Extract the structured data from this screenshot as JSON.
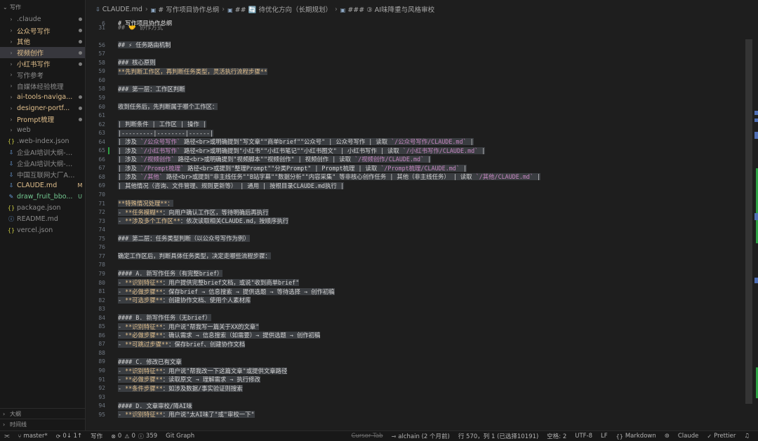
{
  "sidebar": {
    "header": "写作",
    "items": [
      {
        "label": ".claude",
        "type": "folder",
        "color": "gray",
        "deco": "dot"
      },
      {
        "label": "公众号写作",
        "type": "folder",
        "color": "yellow",
        "deco": "dot"
      },
      {
        "label": "其他",
        "type": "folder",
        "color": "yellow",
        "deco": "dot"
      },
      {
        "label": "视频创作",
        "type": "folder",
        "color": "yellow",
        "deco": "dot",
        "selected": true
      },
      {
        "label": "小红书写作",
        "type": "folder",
        "color": "yellow",
        "deco": "dot"
      },
      {
        "label": "写作参考",
        "type": "folder",
        "color": "gray",
        "deco": ""
      },
      {
        "label": "自媒体经验梳理",
        "type": "folder",
        "color": "gray",
        "deco": ""
      },
      {
        "label": "ai-tools-naviga...",
        "type": "folder",
        "color": "yellow",
        "deco": "dot"
      },
      {
        "label": "designer-portf...",
        "type": "folder",
        "color": "yellow",
        "deco": "dot"
      },
      {
        "label": "Prompt梳理",
        "type": "folder",
        "color": "yellow",
        "deco": "dot"
      },
      {
        "label": "web",
        "type": "folder",
        "color": "gray",
        "deco": ""
      },
      {
        "label": ".web-index.json",
        "type": "json",
        "color": "gray",
        "deco": ""
      },
      {
        "label": "企业AI培训大纲-抖音...",
        "type": "md",
        "color": "gray",
        "deco": ""
      },
      {
        "label": "企业AI培训大纲-抖音...",
        "type": "md",
        "color": "gray",
        "deco": ""
      },
      {
        "label": "中国互联网大厂AI编...",
        "type": "md",
        "color": "gray",
        "deco": ""
      },
      {
        "label": "CLAUDE.md",
        "type": "md",
        "color": "yellow",
        "deco": "M"
      },
      {
        "label": "draw_fruit_bbo...",
        "type": "py",
        "color": "green",
        "deco": "U"
      },
      {
        "label": "package.json",
        "type": "json",
        "color": "gray",
        "deco": ""
      },
      {
        "label": "README.md",
        "type": "info",
        "color": "gray",
        "deco": ""
      },
      {
        "label": "vercel.json",
        "type": "json",
        "color": "gray",
        "deco": ""
      }
    ],
    "footer_outline": "大纲",
    "footer_timeline": "时间线"
  },
  "breadcrumb": [
    {
      "icon": "markdown-icon",
      "label": "CLAUDE.md"
    },
    {
      "icon": "heading-icon",
      "label": "# 写作项目协作总纲"
    },
    {
      "icon": "heading-icon",
      "label": "## 🔄 待优化方向（长期规划）"
    },
    {
      "icon": "heading-icon",
      "label": "### ③ AI味降重与风格审校"
    }
  ],
  "sticky": [
    {
      "n": "6",
      "text": "# 写作项目协作总纲"
    },
    {
      "n": "31",
      "text": "## 🤝 协作方式"
    }
  ],
  "lines": [
    {
      "n": "56",
      "text": "## ⚡ 任务路由机制",
      "hl": true
    },
    {
      "n": "57",
      "text": ""
    },
    {
      "n": "58",
      "text": "### 核心原则",
      "hl": true
    },
    {
      "n": "59",
      "text": "**先判断工作区，再判断任务类型，灵活执行流程步骤**",
      "hl": true,
      "color": "yellow"
    },
    {
      "n": "60",
      "text": ""
    },
    {
      "n": "58",
      "text": "### 第一层：工作区判断",
      "hl": true
    },
    {
      "n": "59",
      "text": ""
    },
    {
      "n": "60",
      "text": "收到任务后，先判断属于哪个工作区：",
      "hl": true
    },
    {
      "n": "61",
      "text": ""
    },
    {
      "n": "62",
      "text": "| 判断条件 | 工作区 | 操作 |",
      "hl": true
    },
    {
      "n": "63",
      "text": "|---------|--------|------|",
      "hl": true
    },
    {
      "n": "64",
      "text": "| 涉及 `/公众号写作` 路径<br>或明确提到\"写文章\"\"商单brief\"\"公众号\" | 公众号写作 | 读取 `/公众号写作/CLAUDE.md` |",
      "hl": true,
      "mixed": true
    },
    {
      "n": "65",
      "text": "| 涉及 `/小红书写作` 路径<br>或明确提到\"小红书\"\"小红书笔记\"\"小红书图文\" | 小红书写作 | 读取 `/小红书写作/CLAUDE.md` |",
      "hl": true,
      "mixed": true,
      "mark": true
    },
    {
      "n": "66",
      "text": "| 涉及 `/视频创作` 路径<br>或明确提到\"视频脚本\"\"视频创作\" | 视频创作 | 读取 `/视频创作/CLAUDE.md` |",
      "hl": true,
      "mixed": true
    },
    {
      "n": "67",
      "text": "| 涉及 `/Prompt梳理` 路径<br>或提到\"整理Prompt\"\"分类Prompt\" | Prompt梳理 | 读取 `/Prompt梳理/CLAUDE.md` |",
      "hl": true,
      "mixed": true
    },
    {
      "n": "68",
      "text": "| 涉及 `/其他` 路径<br>或提到\"非主线任务\"\"B站字幕\"\"数据分析\"\"内容采集\" 等非核心创作任务 | 其他（非主线任务） | 读取 `/其他/CLAUDE.md` |",
      "hl": true,
      "mixed": true
    },
    {
      "n": "69",
      "text": "| 其他情况（咨询、文件管理、规则更新等） | 通用 | 按根目录CLAUDE.md执行 |",
      "hl": true
    },
    {
      "n": "70",
      "text": ""
    },
    {
      "n": "71",
      "text": "**特殊情况处理**：",
      "hl": true,
      "color": "yellow"
    },
    {
      "n": "72",
      "text": "- **任务模糊**：向用户确认工作区，等待明确后再执行",
      "hl": true,
      "bullet": true
    },
    {
      "n": "73",
      "text": "- **涉及多个工作区**：依次读取相关CLAUDE.md，按顺序执行",
      "hl": true,
      "bullet": true
    },
    {
      "n": "74",
      "text": ""
    },
    {
      "n": "75",
      "text": "### 第二层：任务类型判断（以公众号写作为例）",
      "hl": true
    },
    {
      "n": "76",
      "text": ""
    },
    {
      "n": "77",
      "text": "确定工作区后，判断具体任务类型，决定走哪些流程步骤：",
      "hl": true
    },
    {
      "n": "78",
      "text": ""
    },
    {
      "n": "79",
      "text": "#### A. 新写作任务（有完整brief）",
      "hl": true
    },
    {
      "n": "80",
      "text": "- **识别特征**：用户提供完整brief文档，或说\"收到商单brief\"",
      "hl": true,
      "bullet": true
    },
    {
      "n": "81",
      "text": "- **必做步骤**：保存brief → 信息搜索 → 提供选题 → 等待选择 → 创作初稿",
      "hl": true,
      "bullet": true
    },
    {
      "n": "82",
      "text": "- **可选步骤**：创建协作文档、使用个人素材库",
      "hl": true,
      "bullet": true
    },
    {
      "n": "83",
      "text": ""
    },
    {
      "n": "84",
      "text": "#### B. 新写作任务（无brief）",
      "hl": true
    },
    {
      "n": "85",
      "text": "- **识别特征**：用户说\"帮我写一篇关于XX的文章\"",
      "hl": true,
      "bullet": true
    },
    {
      "n": "86",
      "text": "- **必做步骤**：确认需求 → 信息搜索（如需要）→ 提供选题 → 创作初稿",
      "hl": true,
      "bullet": true
    },
    {
      "n": "87",
      "text": "- **可跳过步骤**：保存brief、创建协作文档",
      "hl": true,
      "bullet": true
    },
    {
      "n": "88",
      "text": ""
    },
    {
      "n": "89",
      "text": "#### C. 修改已有文章",
      "hl": true
    },
    {
      "n": "90",
      "text": "- **识别特征**：用户说\"帮我改一下这篇文章\"或提供文章路径",
      "hl": true,
      "bullet": true
    },
    {
      "n": "91",
      "text": "- **必做步骤**：读取原文 → 理解需求 → 执行修改",
      "hl": true,
      "bullet": true
    },
    {
      "n": "92",
      "text": "- **条件步骤**：如涉及数据/事实验证则搜索",
      "hl": true,
      "bullet": true
    },
    {
      "n": "93",
      "text": ""
    },
    {
      "n": "94",
      "text": "#### D. 文章审校/降AI味",
      "hl": true
    },
    {
      "n": "95",
      "text": "- **识别特征**：用户说\"太AI味了\"或\"审校一下\"",
      "hl": true,
      "bullet": true
    }
  ],
  "status": {
    "branch": "master*",
    "sync": "0↓ 1↑",
    "workspace": "写作",
    "problems_errors": "0",
    "problems_warnings": "0",
    "info": "359",
    "git_graph": "Git Graph",
    "cursor_tab": "Cursor Tab",
    "blame": "alchain (2 个月前)",
    "position": "行 570，列 1 (已选择10191)",
    "spaces": "空格: 2",
    "encoding": "UTF-8",
    "eol": "LF",
    "language": "Markdown",
    "claude": "Claude",
    "prettier": "Prettier"
  },
  "colors": {
    "heading": "#d4d4d4",
    "bold": "#e2c08d",
    "inline_code": "#c586c0",
    "selection": "#3a3d41"
  }
}
